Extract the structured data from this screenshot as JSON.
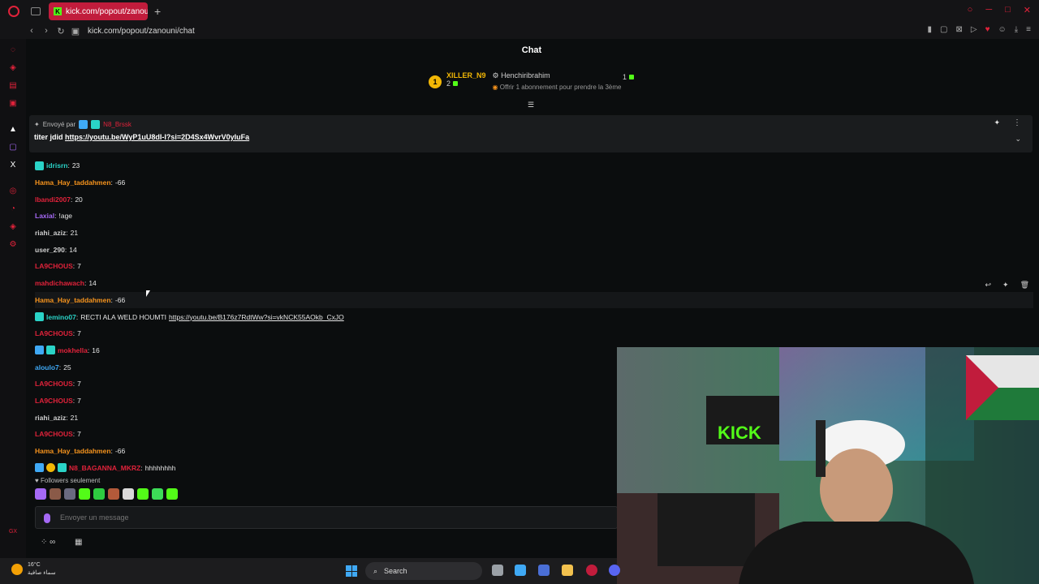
{
  "browser": {
    "tab_title": "kick.com/popout/zanouni",
    "tab_favicon": "K",
    "url": "kick.com/popout/zanouni/chat"
  },
  "chat": {
    "title": "Chat",
    "top_gifters": [
      {
        "rank": "1",
        "name": "XILLER_N9",
        "count": "2"
      },
      {
        "name": "Henchiribrahim",
        "subtitle": "Offrir 1 abonnement pour prendre la 3ème",
        "count": "1"
      }
    ],
    "pinned": {
      "sent_by_label": "Envoyé par",
      "user": "N8_Brssk",
      "message": "titer jdid",
      "link": "https://youtu.be/WyP1uU8dI-I?si=2D4Sx4WvrV0yIuFa"
    },
    "messages": [
      {
        "user": "idrisrn",
        "text": "23",
        "color": "teal",
        "badges": [
          "cyan"
        ]
      },
      {
        "user": "Hama_Hay_taddahmen",
        "text": "-66",
        "color": "orange"
      },
      {
        "user": "lbandi2007",
        "text": "20",
        "color": "red"
      },
      {
        "user": "Laxial",
        "text": "!age",
        "color": "purple"
      },
      {
        "user": "riahi_aziz",
        "text": "21",
        "color": "gray"
      },
      {
        "user": "user_290",
        "text": "14",
        "color": "gray"
      },
      {
        "user": "LA9CHOUS",
        "text": "7",
        "color": "red"
      },
      {
        "user": "mahdichawach",
        "text": "14",
        "color": "red"
      },
      {
        "user": "Hama_Hay_taddahmen",
        "text": "-66",
        "color": "orange",
        "hover": true
      },
      {
        "user": "lemino07",
        "text": "RECTI ALA WELD HOUMTI",
        "link": "https://youtu.be/B176z7RdtWw?si=vkNCK55AOkb_CxJO",
        "color": "teal",
        "badges": [
          "cyan"
        ]
      },
      {
        "user": "LA9CHOUS",
        "text": "7",
        "color": "red"
      },
      {
        "user": "mokhella",
        "text": "16",
        "color": "red",
        "badges": [
          "blue",
          "cyan"
        ]
      },
      {
        "user": "aloulo7",
        "text": "25",
        "color": "blue"
      },
      {
        "user": "LA9CHOUS",
        "text": "7",
        "color": "red"
      },
      {
        "user": "LA9CHOUS",
        "text": "7",
        "color": "red"
      },
      {
        "user": "riahi_aziz",
        "text": "21",
        "color": "gray"
      },
      {
        "user": "LA9CHOUS",
        "text": "7",
        "color": "red"
      },
      {
        "user": "Hama_Hay_taddahmen",
        "text": "-66",
        "color": "orange"
      },
      {
        "user": "N8_BAGANNA_MKRZ",
        "text": "hhhhhhhh",
        "color": "red",
        "badges": [
          "blue",
          "gold",
          "cyan"
        ]
      }
    ],
    "followers_label": "Followers seulement",
    "input_placeholder": "Envoyer un message"
  },
  "taskbar": {
    "temperature": "16°C",
    "weather_text": "سماء صافية",
    "search_label": "Search"
  },
  "colors": {
    "orange": "#f7941d",
    "red": "#e0223a",
    "purple": "#a569f5",
    "teal": "#2ad3c7",
    "blue": "#3fa9f5",
    "gray": "#cfcfcf",
    "kick_green": "#53fc18"
  }
}
